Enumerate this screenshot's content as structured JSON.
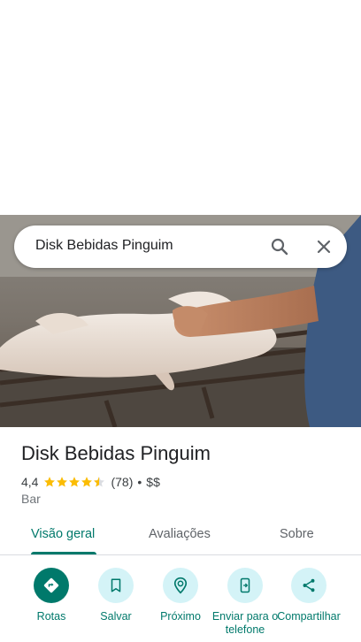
{
  "search": {
    "query": "Disk Bebidas Pinguim"
  },
  "place": {
    "title": "Disk Bebidas Pinguim",
    "rating": "4,4",
    "rating_value": 4.4,
    "reviews": "(78)",
    "separator": "•",
    "price": "$$",
    "category": "Bar"
  },
  "tabs": [
    {
      "label": "Visão geral",
      "active": true
    },
    {
      "label": "Avaliações",
      "active": false
    },
    {
      "label": "Sobre",
      "active": false
    }
  ],
  "actions": [
    {
      "label": "Rotas",
      "icon": "directions-icon"
    },
    {
      "label": "Salvar",
      "icon": "bookmark-icon"
    },
    {
      "label": "Próximo",
      "icon": "nearby-icon"
    },
    {
      "label": "Enviar para o telefone",
      "icon": "send-to-phone-icon"
    },
    {
      "label": "Compartilhar",
      "icon": "share-icon"
    }
  ],
  "colors": {
    "accent": "#00796b",
    "action_bg": "#d4f3f7",
    "star": "#fbbc04"
  }
}
